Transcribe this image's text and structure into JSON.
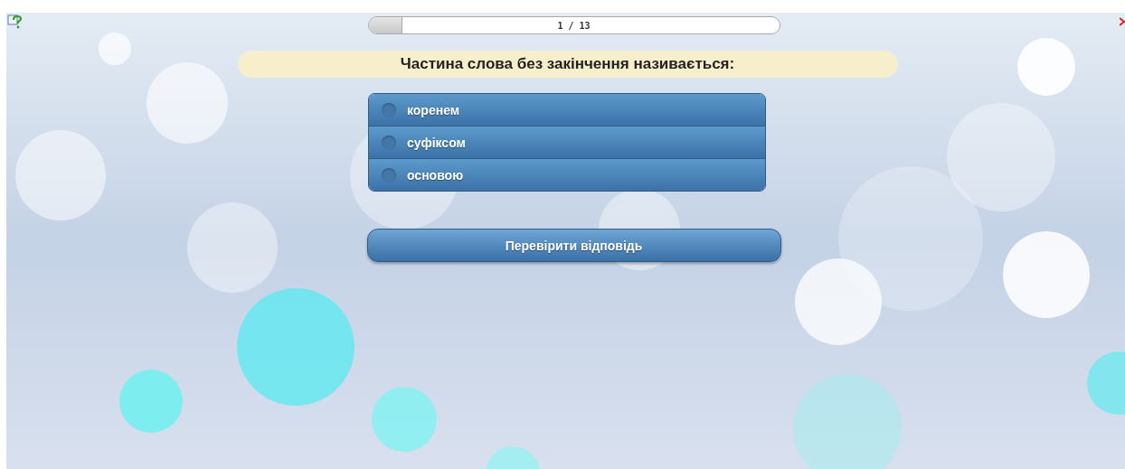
{
  "progress": {
    "label": "1 / 13",
    "level": 0.08
  },
  "question": "Частина слова без закінчення називається:",
  "options": [
    {
      "label": "коренем",
      "selected": false
    },
    {
      "label": "суфіксом",
      "selected": false
    },
    {
      "label": "основою",
      "selected": false
    }
  ],
  "check_button": "Перевірити відповідь"
}
